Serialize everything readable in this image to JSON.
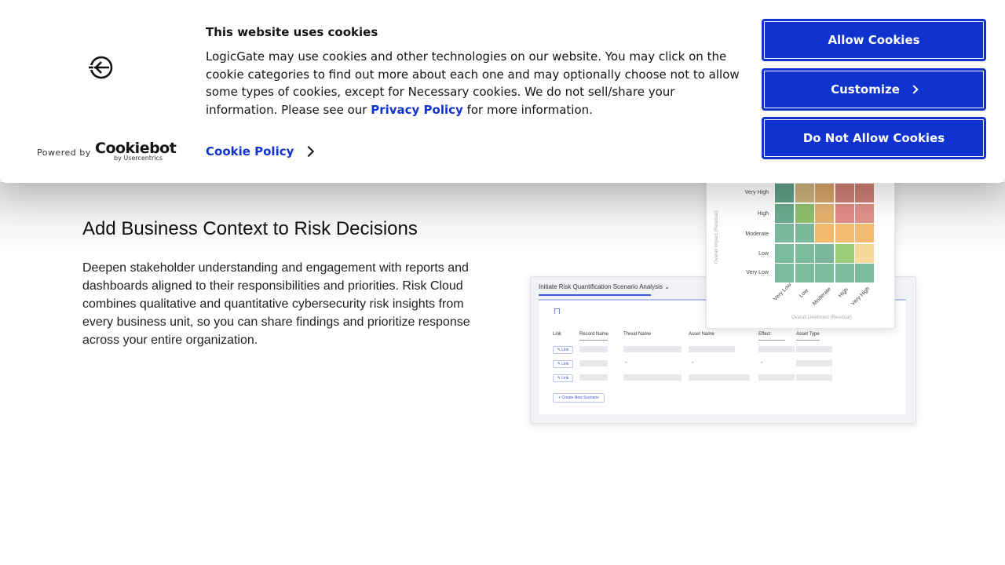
{
  "cookie_banner": {
    "title": "This website uses cookies",
    "text_before_link": "LogicGate may use cookies and other technologies on our website. You may click on the cookie categories to find out more about each one and may optionally choose not to allow some types of cookies, except for Necessary cookies.  We do not sell/share your information. Please see our ",
    "privacy_link": "Privacy Policy",
    "text_after_link": " for more information.",
    "cookie_policy_link": "Cookie Policy",
    "powered_by": "Powered by",
    "cookiebot_brand": "Cookiebot",
    "cookiebot_sub": "by Usercentrics",
    "buttons": {
      "allow": "Allow Cookies",
      "customize": "Customize",
      "deny": "Do Not Allow Cookies"
    },
    "accent_color": "#1032cf"
  },
  "section": {
    "heading": "Add Business Context to Risk Decisions",
    "body": "Deepen stakeholder understanding and engagement with reports and dashboards aligned to their responsibilities and priorities. Risk Cloud combines qualitative and quantitative cybersecurity risk insights from every business unit, so you can share findings and prioritize response across your entire organization."
  },
  "product_image": {
    "table_title": "Initiate Risk Quantification Scenario Analysis ⌄",
    "columns": [
      "Link",
      "Record Name",
      "Threat Name",
      "Asset Name",
      "Effect",
      "Asset Type"
    ],
    "row_link_label": "✎ Link",
    "row_dash": "-",
    "create_button": "+ Create New Scenario",
    "heatmap": {
      "y_labels": [
        "Very High",
        "High",
        "Moderate",
        "Low",
        "Very Low"
      ],
      "x_labels": [
        "Very Low",
        "Low",
        "Moderate",
        "High",
        "Very High"
      ],
      "y_axis_title": "Overall Impact (Residual)",
      "x_axis_title": "Overall Likelihood (Residual)",
      "cell_colors": [
        [
          "#5f9e85",
          "#cbb27a",
          "#d6a46a",
          "#cf7e74",
          "#cc7e73"
        ],
        [
          "#6aaa8d",
          "#8ebf6c",
          "#e4b06f",
          "#e08a84",
          "#e0918a"
        ],
        [
          "#7bb89b",
          "#7bb89b",
          "#f1b96c",
          "#f2bd72",
          "#f2bd72"
        ],
        [
          "#7bbc9c",
          "#7bbc9c",
          "#7bb89b",
          "#9ccd7b",
          "#f6d99a"
        ],
        [
          "#7bbc9c",
          "#7bbc9c",
          "#7bbc9c",
          "#7bbc9c",
          "#7bbc9c"
        ]
      ]
    }
  }
}
